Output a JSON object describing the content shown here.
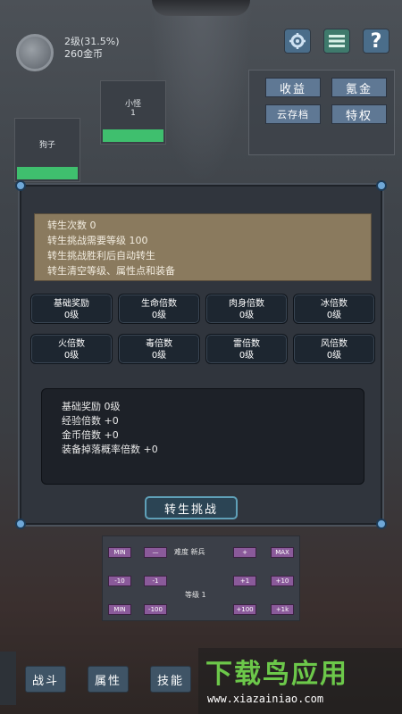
{
  "header": {
    "level_text": "2级(31.5%)",
    "gold_text": "260金币",
    "help_label": "?"
  },
  "side_menu": {
    "income": "收益",
    "recharge": "氪金",
    "cloud_save": "云存档",
    "privilege": "特权"
  },
  "enemy_cards": [
    {
      "name": "小怪",
      "level": "1"
    },
    {
      "name": "狗子",
      "level": ""
    }
  ],
  "rebirth": {
    "info_lines": [
      "转生次数 0",
      "转生挑战需要等级 100",
      "转生挑战胜利后自动转生",
      "转生清空等级、属性点和装备"
    ],
    "multipliers": [
      {
        "label": "基础奖励",
        "value": "0级"
      },
      {
        "label": "生命倍数",
        "value": "0级"
      },
      {
        "label": "肉身倍数",
        "value": "0级"
      },
      {
        "label": "冰倍数",
        "value": "0级"
      },
      {
        "label": "火倍数",
        "value": "0级"
      },
      {
        "label": "毒倍数",
        "value": "0级"
      },
      {
        "label": "雷倍数",
        "value": "0级"
      },
      {
        "label": "风倍数",
        "value": "0级"
      }
    ],
    "summary_lines": [
      "基础奖励 0级",
      "经验倍数 +0",
      "金币倍数 +0",
      "装备掉落概率倍数 +0"
    ],
    "challenge_button": "转生挑战"
  },
  "difficulty": {
    "label": "难度 新兵",
    "level_label": "等级 1",
    "buttons": {
      "min1": "MIN",
      "minus": "—",
      "plus": "+",
      "max1": "MAX",
      "m10": "-10",
      "m1": "-1",
      "p1": "+1",
      "p10": "+10",
      "min2": "MIN",
      "m100": "-100",
      "p100": "+100",
      "p1k": "+1k"
    }
  },
  "bottom_nav": {
    "battle": "战斗",
    "attributes": "属性",
    "skills": "技能"
  },
  "watermark": {
    "title": "下载鸟应用",
    "url": "www.xiazainiao.com"
  },
  "colors": {
    "hp_bar": "#3fbf6e",
    "info_box": "#8a7a5e",
    "watermark_green": "#6cc84a"
  }
}
